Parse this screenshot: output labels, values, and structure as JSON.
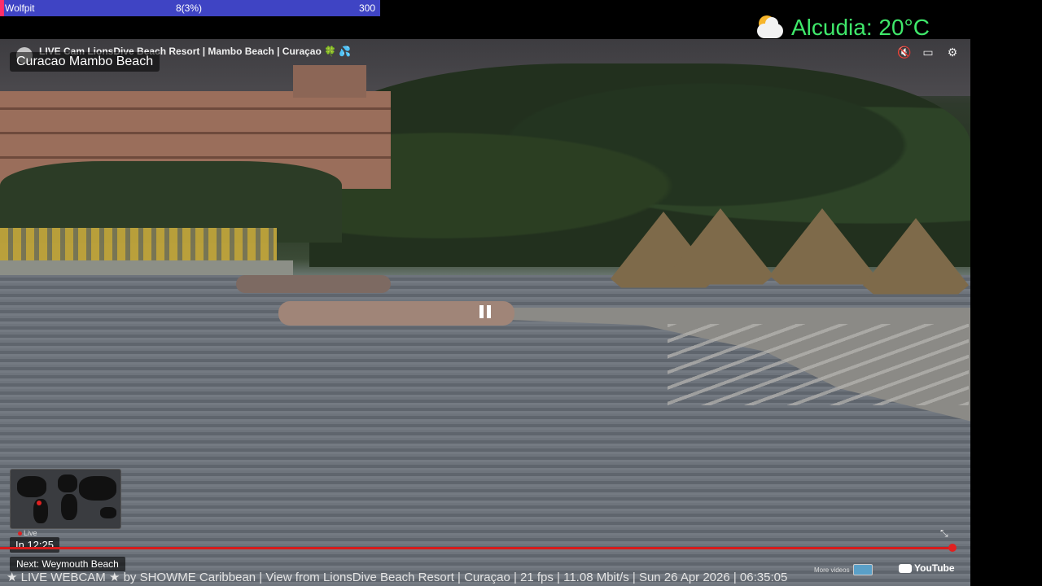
{
  "goal_bar": {
    "name": "Wolfpit",
    "count": "8(3%)",
    "goal": "300",
    "accent": "#3f44c4",
    "edge_color": "#ff2e6a"
  },
  "weather": {
    "icon": "partly-cloudy-icon",
    "text": "Alcudia: 20°C",
    "color": "#3fe86a"
  },
  "video": {
    "overlay_title": "Curacao Mambo Beach",
    "yt_title": "LIVE Cam LionsDive Beach Resort | Mambo Beach | Curaçao 🍀 💦",
    "controls": [
      "mute-icon",
      "captions-icon",
      "settings-icon"
    ],
    "live_label": "Live",
    "in_time": "In 12:25",
    "next": "Next: Weymouth Beach",
    "more_videos": "More videos",
    "youtube": "YouTube",
    "progress_color": "#d81b1b"
  },
  "ticker": "★ LIVE WEBCAM ★ by SHOWME Caribbean | View from LionsDive Beach Resort | Curaçao | 21 fps | 11.08 Mbit/s | Sun 26 Apr 2026 | 06:35:05"
}
